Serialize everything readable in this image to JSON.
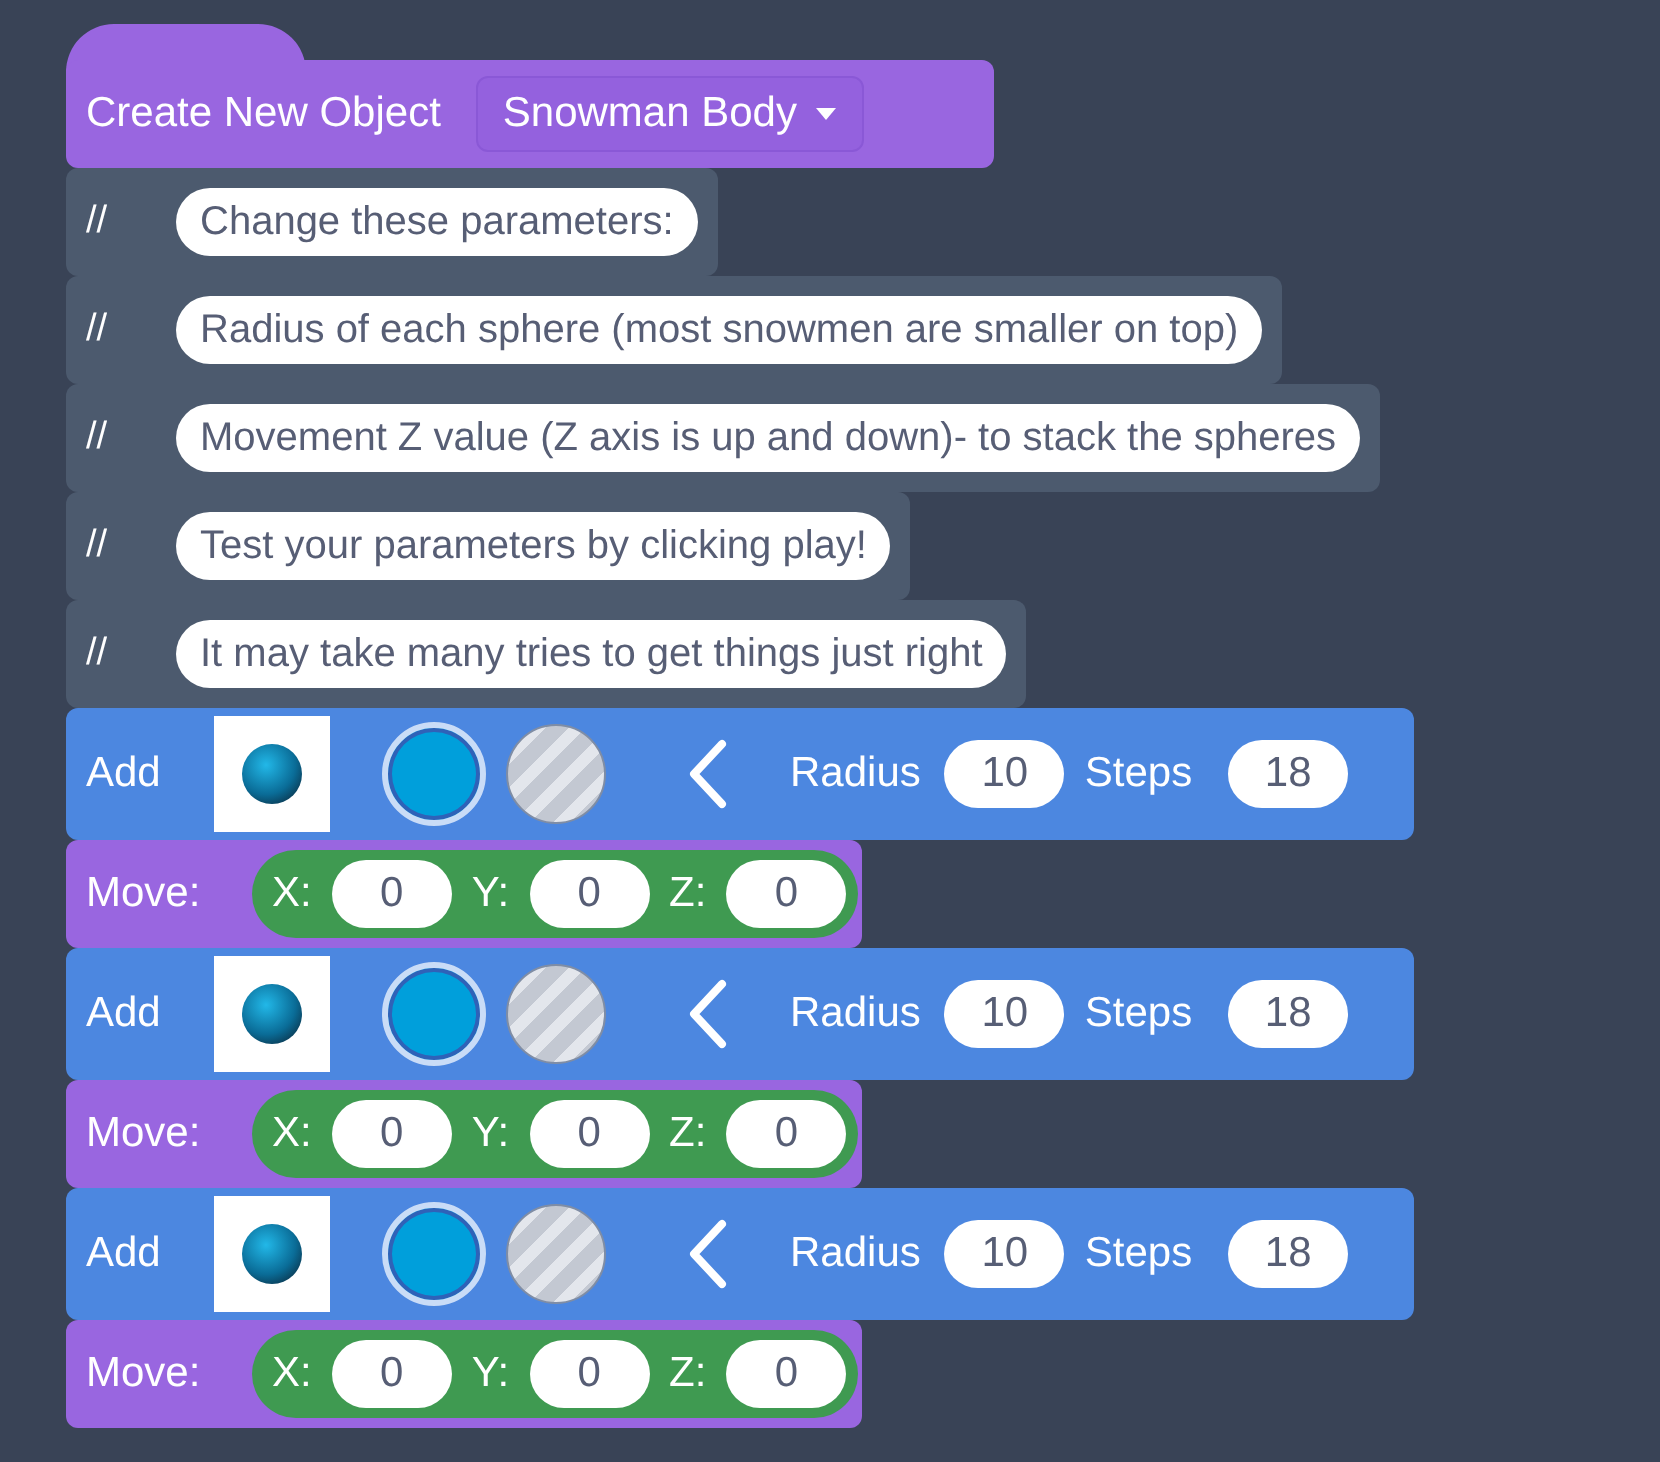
{
  "hat": {
    "label": "Create New Object",
    "dropdown": "Snowman Body"
  },
  "comments": [
    {
      "marker": "//",
      "text": "Change these parameters:"
    },
    {
      "marker": "//",
      "text": "Radius of each sphere (most snowmen are smaller on top)"
    },
    {
      "marker": "//",
      "text": "Movement Z value (Z axis is up and down)- to stack the spheres"
    },
    {
      "marker": "//",
      "text": "Test your parameters by clicking play!"
    },
    {
      "marker": "//",
      "text": "It may take many tries to get things just right"
    }
  ],
  "steps": [
    {
      "kind": "add",
      "label": "Add",
      "swatches": [
        {
          "kind": "solid",
          "color": "#009fdb",
          "selected": true
        },
        {
          "kind": "striped",
          "color": "#c3c8d2",
          "selected": false
        }
      ],
      "radius_label": "Radius",
      "radius": "10",
      "steps_label": "Steps",
      "steps": "18"
    },
    {
      "kind": "move",
      "label": "Move:",
      "axes": [
        {
          "label": "X:",
          "value": "0"
        },
        {
          "label": "Y:",
          "value": "0"
        },
        {
          "label": "Z:",
          "value": "0"
        }
      ]
    },
    {
      "kind": "add",
      "label": "Add",
      "swatches": [
        {
          "kind": "solid",
          "color": "#009fdb",
          "selected": true
        },
        {
          "kind": "striped",
          "color": "#c3c8d2",
          "selected": false
        }
      ],
      "radius_label": "Radius",
      "radius": "10",
      "steps_label": "Steps",
      "steps": "18"
    },
    {
      "kind": "move",
      "label": "Move:",
      "axes": [
        {
          "label": "X:",
          "value": "0"
        },
        {
          "label": "Y:",
          "value": "0"
        },
        {
          "label": "Z:",
          "value": "0"
        }
      ]
    },
    {
      "kind": "add",
      "label": "Add",
      "swatches": [
        {
          "kind": "solid",
          "color": "#009fdb",
          "selected": true
        },
        {
          "kind": "striped",
          "color": "#c3c8d2",
          "selected": false
        }
      ],
      "radius_label": "Radius",
      "radius": "10",
      "steps_label": "Steps",
      "steps": "18"
    },
    {
      "kind": "move",
      "label": "Move:",
      "axes": [
        {
          "label": "X:",
          "value": "0"
        },
        {
          "label": "Y:",
          "value": "0"
        },
        {
          "label": "Z:",
          "value": "0"
        }
      ]
    }
  ]
}
